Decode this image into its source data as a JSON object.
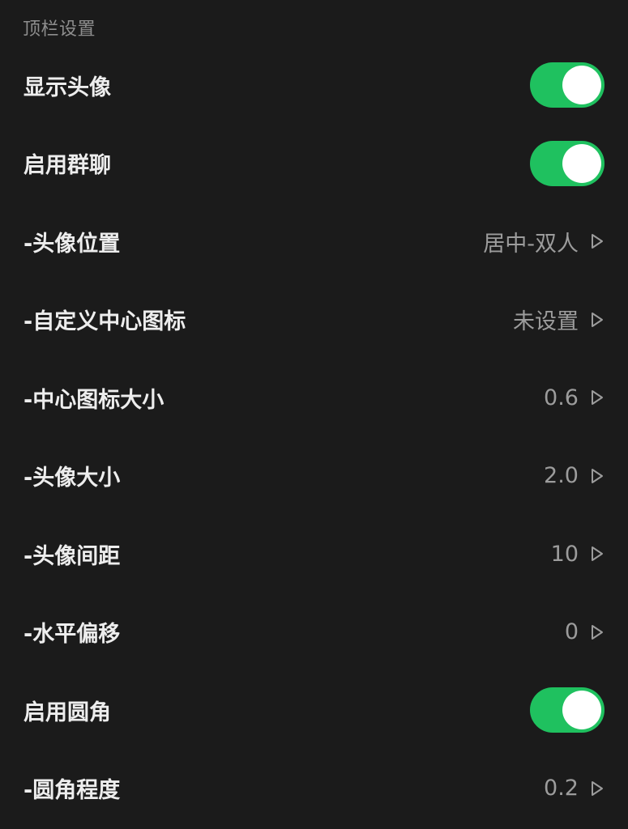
{
  "section": {
    "title": "顶栏设置"
  },
  "colors": {
    "background": "#1b1b1b",
    "toggle_on": "#1fc15f",
    "label": "#ededed",
    "value": "#9c9c9c",
    "section_title": "#8e8e8e"
  },
  "settings": [
    {
      "label": "显示头像",
      "type": "toggle",
      "on": true
    },
    {
      "label": "启用群聊",
      "type": "toggle",
      "on": true
    },
    {
      "label": "-头像位置",
      "type": "value",
      "value": "居中-双人",
      "icon": "chevron-right-icon"
    },
    {
      "label": "-自定义中心图标",
      "type": "value",
      "value": "未设置",
      "icon": "chevron-right-icon"
    },
    {
      "label": "-中心图标大小",
      "type": "value",
      "value": "0.6",
      "icon": "chevron-right-icon"
    },
    {
      "label": "-头像大小",
      "type": "value",
      "value": "2.0",
      "icon": "chevron-right-icon"
    },
    {
      "label": "-头像间距",
      "type": "value",
      "value": "10",
      "icon": "chevron-right-icon"
    },
    {
      "label": "-水平偏移",
      "type": "value",
      "value": "0",
      "icon": "chevron-right-icon"
    },
    {
      "label": "启用圆角",
      "type": "toggle",
      "on": true
    },
    {
      "label": "-圆角程度",
      "type": "value",
      "value": "0.2",
      "icon": "chevron-right-icon"
    }
  ]
}
